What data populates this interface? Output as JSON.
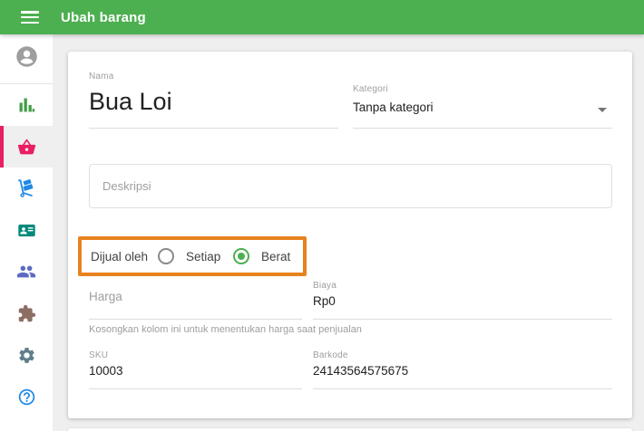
{
  "header": {
    "title": "Ubah barang",
    "background_color": "#4CAF50",
    "menu_icon": "hamburger-icon"
  },
  "sidebar": {
    "selected_index": 2,
    "selected_accent_color": "#E91E63",
    "items": [
      {
        "icon": "avatar-icon",
        "color": "#9E9E9E",
        "selected": false
      },
      {
        "icon": "bar-chart-icon",
        "color": "#43A047",
        "selected": false
      },
      {
        "icon": "basket-icon",
        "color": "#E91E63",
        "selected": true
      },
      {
        "icon": "hand-truck-icon",
        "color": "#1E88E5",
        "selected": false
      },
      {
        "icon": "contact-card-icon",
        "color": "#00897B",
        "selected": false
      },
      {
        "icon": "people-icon",
        "color": "#5C6BC0",
        "selected": false
      },
      {
        "icon": "puzzle-icon",
        "color": "#8D6E63",
        "selected": false
      },
      {
        "icon": "gear-icon",
        "color": "#607D8B",
        "selected": false
      },
      {
        "icon": "help-icon",
        "color": "#1E88E5",
        "selected": false
      }
    ]
  },
  "form": {
    "nama": {
      "label": "Nama",
      "value": "Bua Loi"
    },
    "kategori": {
      "label": "Kategori",
      "value": "Tanpa kategori",
      "dropdown_icon": "chevron-down-icon"
    },
    "deskripsi": {
      "placeholder": "Deskripsi",
      "value": ""
    },
    "dijual_oleh": {
      "label": "Dijual oleh",
      "options": [
        {
          "label": "Setiap",
          "selected": false
        },
        {
          "label": "Berat",
          "selected": true
        }
      ],
      "selected_value": "Berat",
      "radio_selected_color": "#4CAF50",
      "highlight_color": "#E8821E"
    },
    "harga": {
      "label": "Harga",
      "placeholder": "Harga",
      "value": "",
      "hint": "Kosongkan kolom ini untuk menentukan harga saat penjualan"
    },
    "biaya": {
      "label": "Biaya",
      "value": "Rp0"
    },
    "sku": {
      "label": "SKU",
      "value": "10003"
    },
    "barkode": {
      "label": "Barkode",
      "value": "24143564575675"
    }
  }
}
